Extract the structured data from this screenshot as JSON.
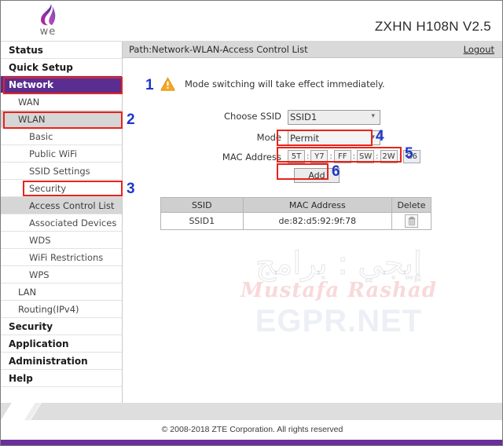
{
  "header": {
    "logo_name": "we-logo",
    "logo_text": "we",
    "model_title": "ZXHN H108N V2.5"
  },
  "sidebar": {
    "items": [
      {
        "label": "Status",
        "level": 1,
        "state": "normal"
      },
      {
        "label": "Quick Setup",
        "level": 1,
        "state": "normal"
      },
      {
        "label": "Network",
        "level": 1,
        "state": "active"
      },
      {
        "label": "WAN",
        "level": 2,
        "state": "normal"
      },
      {
        "label": "WLAN",
        "level": 2,
        "state": "selected"
      },
      {
        "label": "Basic",
        "level": 3,
        "state": "normal"
      },
      {
        "label": "Public WiFi",
        "level": 3,
        "state": "normal"
      },
      {
        "label": "SSID Settings",
        "level": 3,
        "state": "normal"
      },
      {
        "label": "Security",
        "level": 3,
        "state": "normal"
      },
      {
        "label": "Access Control List",
        "level": 3,
        "state": "selected"
      },
      {
        "label": "Associated Devices",
        "level": 3,
        "state": "normal"
      },
      {
        "label": "WDS",
        "level": 3,
        "state": "normal"
      },
      {
        "label": "WiFi Restrictions",
        "level": 3,
        "state": "normal"
      },
      {
        "label": "WPS",
        "level": 3,
        "state": "normal"
      },
      {
        "label": "LAN",
        "level": 2,
        "state": "normal"
      },
      {
        "label": "Routing(IPv4)",
        "level": 2,
        "state": "normal"
      },
      {
        "label": "Security",
        "level": 1,
        "state": "normal"
      },
      {
        "label": "Application",
        "level": 1,
        "state": "normal"
      },
      {
        "label": "Administration",
        "level": 1,
        "state": "normal"
      },
      {
        "label": "Help",
        "level": 1,
        "state": "normal"
      }
    ],
    "help_button": {
      "label": "Help",
      "badge": "?"
    }
  },
  "path_bar": {
    "path": "Path:Network-WLAN-Access Control List",
    "logout": "Logout"
  },
  "notice": {
    "icon": "warning-icon",
    "text": "Mode switching will take effect immediately."
  },
  "form": {
    "ssid_label": "Choose SSID",
    "ssid_value": "SSID1",
    "ssid_options": [
      "SSID1"
    ],
    "mode_label": "Mode",
    "mode_value": "Permit",
    "mode_options": [
      "Permit"
    ],
    "mac_label": "MAC Address",
    "mac_octets": [
      "5T",
      "Y7",
      "FF",
      "SW",
      "2W",
      "G6"
    ],
    "mac_separator": ":",
    "add_label": "Add"
  },
  "table": {
    "columns": [
      "SSID",
      "MAC Address",
      "Delete"
    ],
    "rows": [
      {
        "ssid": "SSID1",
        "mac": "de:82:d5:92:9f:78",
        "delete_icon": "trash-icon"
      }
    ]
  },
  "watermark": {
    "arabic": "إيجي : برامج",
    "name": "Mustafa Rashad",
    "site": "EGPR.NET"
  },
  "footer": {
    "copyright": "© 2008-2018 ZTE Corporation. All rights reserved"
  },
  "annotations": {
    "n1": "1",
    "n2": "2",
    "n3": "3",
    "n4": "4",
    "n5": "5",
    "n6": "6"
  },
  "colors": {
    "brand_purple": "#5a2d91",
    "footer_purple": "#6a2f9b",
    "annotation_red": "#e8231a",
    "annotation_blue": "#1f37c9"
  }
}
